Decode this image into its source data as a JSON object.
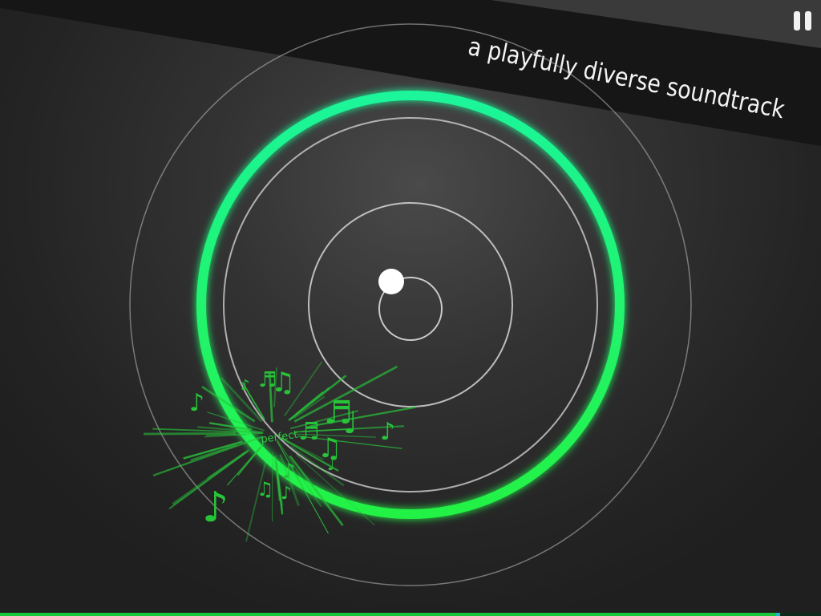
{
  "banner": {
    "text": "a playfully diverse soundtrack"
  },
  "hud": {
    "pause_icon": "pause-icon"
  },
  "feedback": {
    "label": "perfect"
  },
  "colors": {
    "beat_ring": "#22f28a",
    "beat_ring_glow": "#1de36a",
    "guide_rings": "#c9c9c9",
    "player_dot": "#ffffff",
    "notes": "#27c43a",
    "progress": "#17c63a"
  },
  "progress": {
    "fraction": 0.945
  }
}
